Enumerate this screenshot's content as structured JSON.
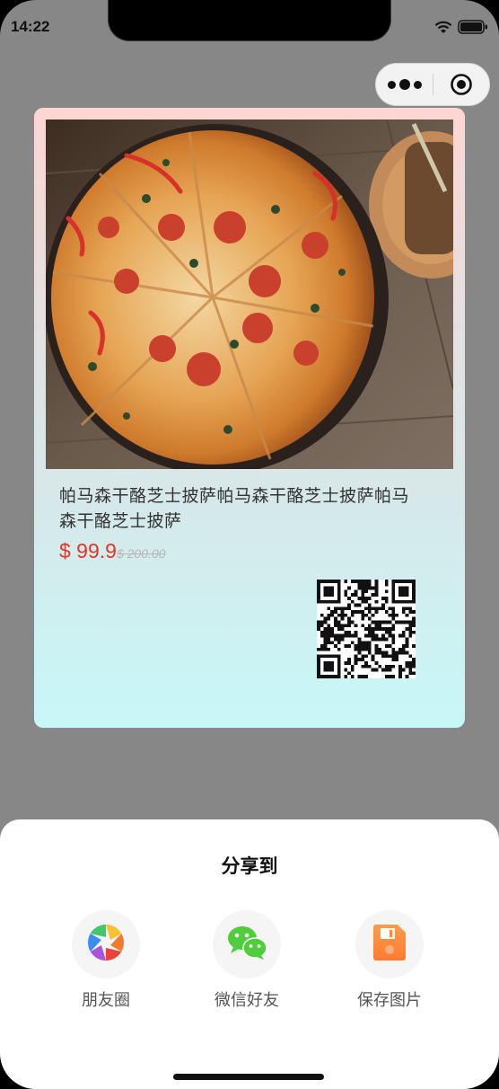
{
  "status_bar": {
    "time": "14:22"
  },
  "poster": {
    "title": "帕马森干酪芝士披萨帕马森干酪芝士披萨帕马森干酪芝士披萨",
    "price": "$ 99.9",
    "original_price": "$ 200.00"
  },
  "share_sheet": {
    "title": "分享到",
    "options": [
      {
        "label": "朋友圈",
        "icon": "moments-icon"
      },
      {
        "label": "微信好友",
        "icon": "wechat-icon"
      },
      {
        "label": "保存图片",
        "icon": "save-image-icon"
      }
    ]
  },
  "colors": {
    "price": "#e8332a",
    "wechat_green": "#4fcd3a",
    "save_orange": "#ff8a3d"
  }
}
